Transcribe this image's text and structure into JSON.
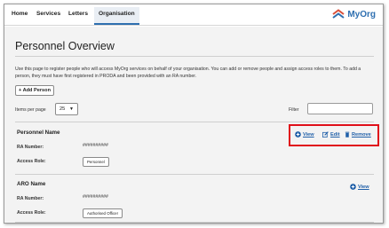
{
  "nav": {
    "items": [
      {
        "label": "Home"
      },
      {
        "label": "Services"
      },
      {
        "label": "Letters"
      },
      {
        "label": "Organisation"
      }
    ],
    "logo_text": "MyOrg",
    "logo_icon": "chevron-stack-icon"
  },
  "page": {
    "title": "Personnel Overview",
    "intro": "Use this page to register people who will access MyOrg services on behalf of your organisation. You can add or remove people and assign access roles to them. To add a person, they must have first registered in PRODA and been provided with an RA number.",
    "add_button": "+ Add Person",
    "items_per_page_label": "Items per page",
    "items_per_page_value": "25",
    "filter_label": "Filter",
    "filter_value": ""
  },
  "records": [
    {
      "name": "Personnel Name",
      "ra_label": "RA Number:",
      "ra_value": "##########",
      "role_label": "Access Role:",
      "role_value": "Personnel",
      "actions": {
        "view": "View",
        "edit": "Edit",
        "remove": "Remove"
      }
    },
    {
      "name": "ARO Name",
      "ra_label": "RA Number:",
      "ra_value": "##########",
      "role_label": "Access Role:",
      "role_value": "Authorised Officer",
      "actions": {
        "view": "View"
      }
    }
  ],
  "colors": {
    "accent": "#2e6fb0",
    "link": "#1f5fa8",
    "highlight": "#e0101a",
    "content_bg": "#f3f3f3"
  }
}
